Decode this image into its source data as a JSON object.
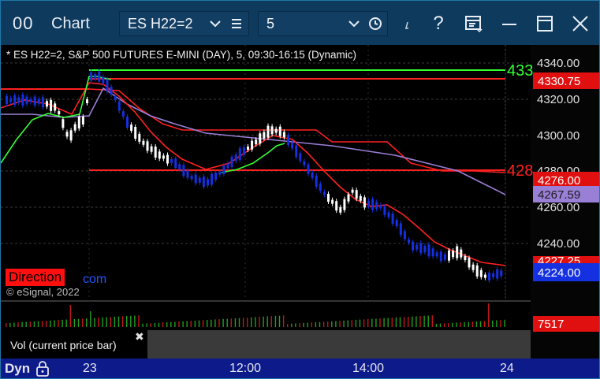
{
  "titlebar": {
    "logo": "00",
    "title": "Chart",
    "symbol": "ES H22=2",
    "interval": "5",
    "help": "?"
  },
  "chart": {
    "description": "* ES H22=2, S&P 500 FUTURES E-MINI (DAY), 5, 09:30-16:15 (Dynamic)",
    "copyright": "© eSignal, 2022",
    "direction_label": "Direction",
    "direction_suffix": "com",
    "price_ticks": [
      "4340.00",
      "4320.00",
      "4300.00",
      "4280.00",
      "4260.00",
      "4240.00"
    ],
    "line_labels": {
      "green_level": "433",
      "red_level": "428"
    },
    "price_tags": {
      "upper_red": "4330.75",
      "lower_red": "4276.00",
      "purple": "4267.59",
      "current": "4224.00",
      "hidden_red": "4227.25"
    },
    "volume_tag": "7517",
    "volume_study": "Vol (current price bar)",
    "close_icon": "✖"
  },
  "time_axis": {
    "mode": "Dyn",
    "ticks": [
      "23",
      "12:00",
      "14:00",
      "24"
    ]
  },
  "colors": {
    "titlebar": "#0e3a5e",
    "up_candle": "#ffffff",
    "down_candle": "#1530e0",
    "red_line": "#ff2020",
    "green_line": "#33ff33",
    "purple_line": "#9a7fd6",
    "time_axis": "#0c1a8a"
  }
}
